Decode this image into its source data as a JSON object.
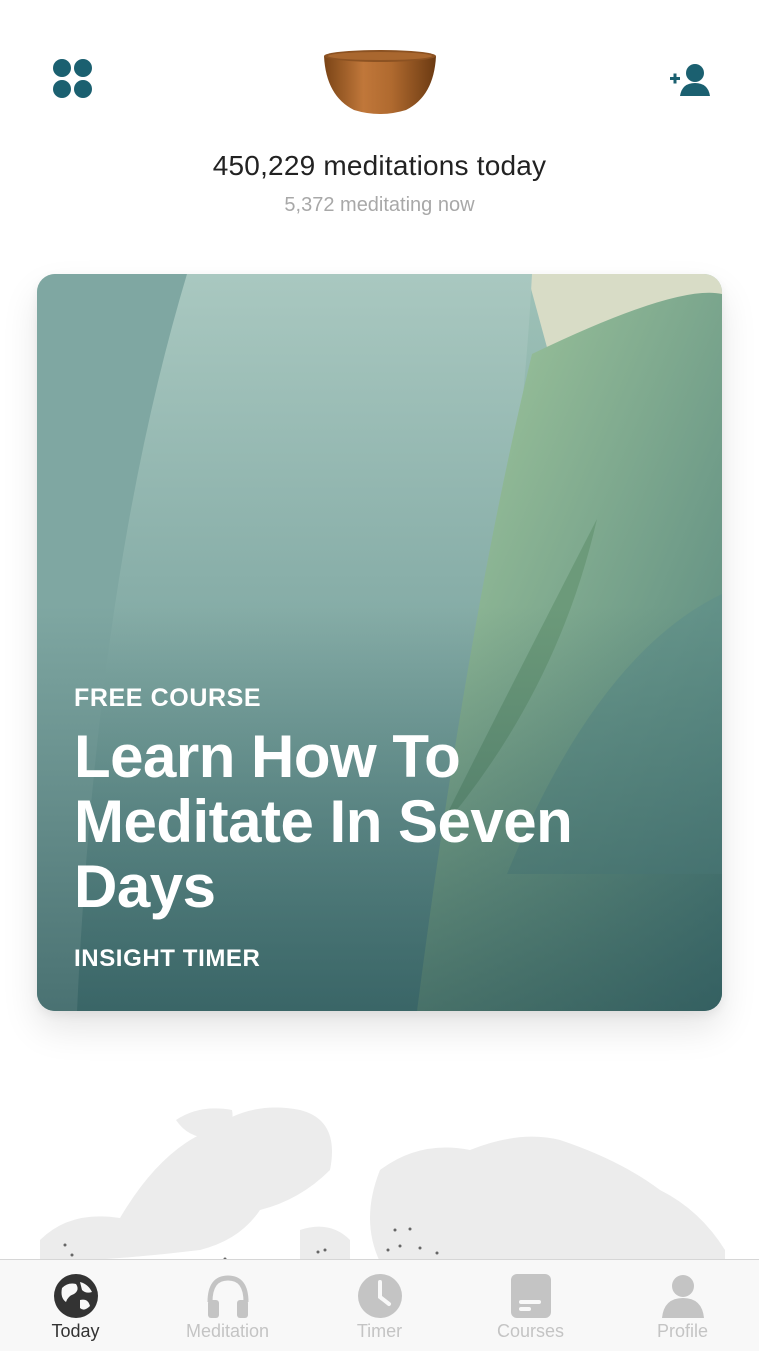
{
  "header": {
    "apps_icon": "apps-grid-icon",
    "logo": "singing-bowl-logo",
    "add_friend_icon": "add-friend-icon",
    "meditations_today": "450,229 meditations today",
    "meditating_now": "5,372 meditating now"
  },
  "featured": {
    "label": "FREE COURSE",
    "title": "Learn How To Meditate In Seven Days",
    "author": "INSIGHT TIMER"
  },
  "tabbar": {
    "tabs": [
      {
        "label": "Today",
        "icon": "globe-icon",
        "active": true
      },
      {
        "label": "Meditation",
        "icon": "headphones-icon",
        "active": false
      },
      {
        "label": "Timer",
        "icon": "clock-icon",
        "active": false
      },
      {
        "label": "Courses",
        "icon": "course-card-icon",
        "active": false
      },
      {
        "label": "Profile",
        "icon": "person-icon",
        "active": false
      }
    ]
  },
  "colors": {
    "accent": "#1b6070",
    "card_teal": "#3f6e72",
    "tab_inactive": "#c4c4c4",
    "tab_active": "#333333"
  }
}
